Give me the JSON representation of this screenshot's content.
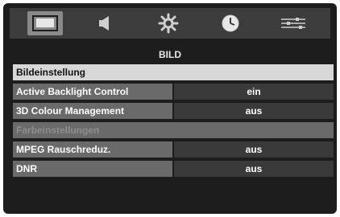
{
  "tabs": [
    {
      "icon": "picture-icon",
      "active": true
    },
    {
      "icon": "speaker-icon",
      "active": false
    },
    {
      "icon": "gear-icon",
      "active": false
    },
    {
      "icon": "clock-icon",
      "active": false
    },
    {
      "icon": "sliders-icon",
      "active": false
    }
  ],
  "menu": {
    "title": "BILD",
    "header": "Bildeinstellung",
    "items": [
      {
        "label": "Active Backlight Control",
        "value": "ein"
      },
      {
        "label": "3D Colour Management",
        "value": "aus"
      },
      {
        "label": "Farbeinstellungen"
      },
      {
        "label": "MPEG Rauschreduz.",
        "value": "aus"
      },
      {
        "label": "DNR",
        "value": "aus"
      }
    ]
  },
  "colors": {
    "background": "#1d1d1d",
    "tabbar": "#3c3c3c",
    "active_tab": "#8a8a8a",
    "header_row": "#d7d7d7",
    "label_cell": "#6a6a6a",
    "value_cell": "#3a3a3a"
  }
}
